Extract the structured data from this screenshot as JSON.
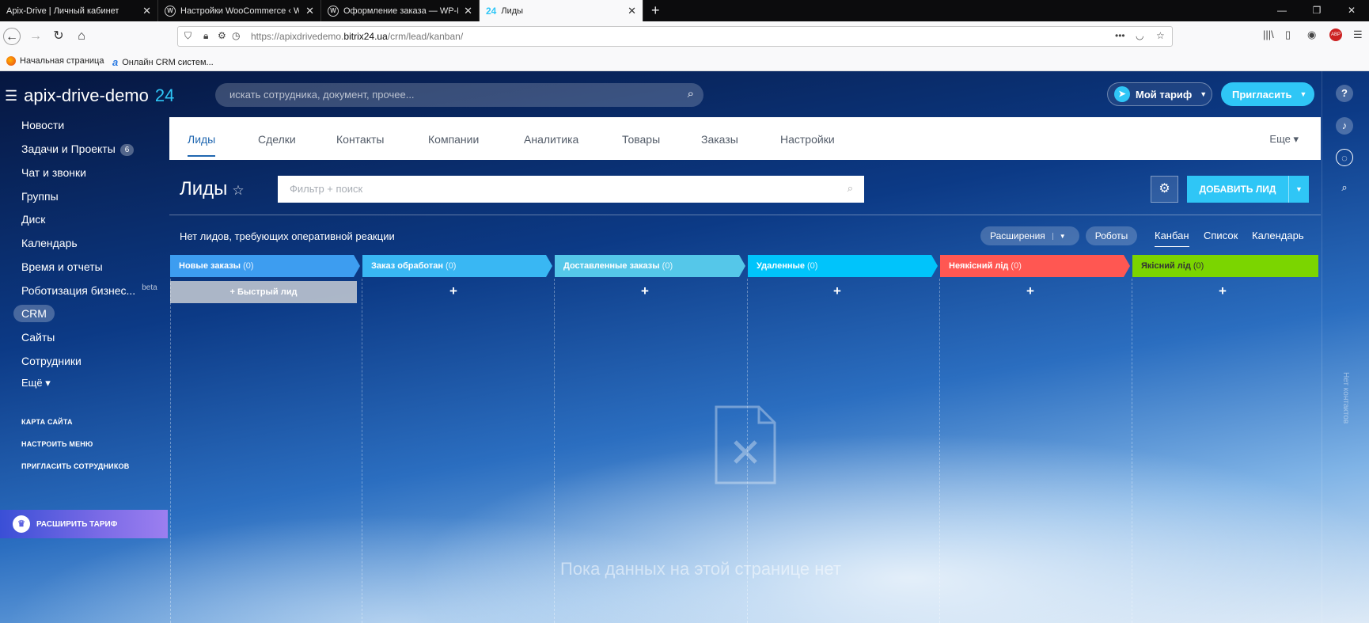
{
  "browser": {
    "tabs": [
      {
        "label": "Apix-Drive | Личный кабинет"
      },
      {
        "label": "Настройки WooCommerce ‹ W"
      },
      {
        "label": "Оформление заказа — WP-D"
      },
      {
        "label": "Лиды",
        "icon_text": "24"
      }
    ],
    "new_tab": "+",
    "url_prefix": "https://apixdrivedemo.",
    "url_domain": "bitrix24.ua",
    "url_path": "/crm/lead/kanban/",
    "bookmarks": [
      {
        "label": "Начальная страница"
      },
      {
        "label": "Онлайн CRM систем..."
      }
    ]
  },
  "app": {
    "logo": "apix-drive-demo",
    "logo_num": "24",
    "search_placeholder": "искать сотрудника, документ, прочее...",
    "tariff_button": "Мой тариф",
    "invite_button": "Пригласить",
    "vertical_label": "Нет контактов"
  },
  "leftmenu": {
    "items": [
      {
        "label": "Новости"
      },
      {
        "label": "Задачи и Проекты",
        "badge": "6"
      },
      {
        "label": "Чат и звонки"
      },
      {
        "label": "Группы"
      },
      {
        "label": "Диск"
      },
      {
        "label": "Календарь"
      },
      {
        "label": "Время и отчеты"
      },
      {
        "label": "Роботизация бизнес...",
        "beta": "beta"
      },
      {
        "label": "CRM"
      },
      {
        "label": "Сайты"
      },
      {
        "label": "Сотрудники"
      },
      {
        "label": "Ещё ▾"
      }
    ],
    "links": [
      "КАРТА САЙТА",
      "НАСТРОИТЬ МЕНЮ",
      "ПРИГЛАСИТЬ СОТРУДНИКОВ"
    ],
    "expand": "РАСШИРИТЬ ТАРИФ"
  },
  "crmnav": {
    "tabs": [
      "Лиды",
      "Сделки",
      "Контакты",
      "Компании",
      "Аналитика",
      "Товары",
      "Заказы",
      "Настройки"
    ],
    "more": "Еще ▾"
  },
  "page": {
    "title": "Лиды",
    "filter_placeholder": "Фильтр + поиск",
    "add_button": "ДОБАВИТЬ ЛИД",
    "notice": "Нет лидов, требующих оперативной реакции",
    "extensions": "Расширения",
    "robots": "Роботы",
    "views": [
      "Канбан",
      "Список",
      "Календарь"
    ],
    "empty_text": "Пока данных на этой странице нет"
  },
  "kanban": {
    "stages": [
      {
        "name": "Новые заказы",
        "count": "(0)",
        "color": "#3d9df0"
      },
      {
        "name": "Заказ обработан",
        "count": "(0)",
        "color": "#39b7f3"
      },
      {
        "name": "Доставленные заказы",
        "count": "(0)",
        "color": "#55c7e9"
      },
      {
        "name": "Удаленные",
        "count": "(0)",
        "color": "#00c4fb"
      },
      {
        "name": "Неякісний лід",
        "count": "(0)",
        "color": "#ff5752"
      },
      {
        "name": "Якісний лід",
        "count": "(0)",
        "color": "#7bd500"
      }
    ],
    "quick_lead": "Быстрый лид",
    "plus": "+"
  }
}
